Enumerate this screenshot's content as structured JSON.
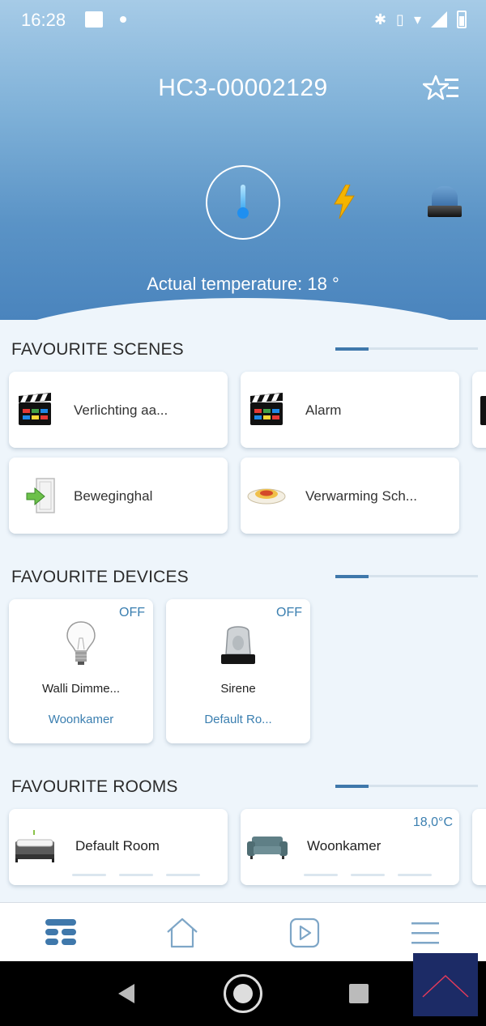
{
  "status_bar": {
    "time": "16:28",
    "icons": [
      "image-icon",
      "dot-icon",
      "bluetooth-icon",
      "vibrate-icon",
      "wifi-icon",
      "signal-icon",
      "battery-icon"
    ]
  },
  "header": {
    "title": "HC3-00002129",
    "actual_temperature_label": "Actual temperature:",
    "actual_temperature_value": "18 °"
  },
  "sections": {
    "scenes": {
      "title": "FAVOURITE SCENES",
      "items": [
        {
          "label": "Verlichting aa...",
          "icon": "clapperboard-icon"
        },
        {
          "label": "Alarm",
          "icon": "clapperboard-icon"
        },
        {
          "label": "Beweginghal",
          "icon": "door-arrow-icon"
        },
        {
          "label": "Verwarming Sch...",
          "icon": "pasta-plate-icon"
        }
      ]
    },
    "devices": {
      "title": "FAVOURITE DEVICES",
      "items": [
        {
          "name": "Walli Dimme...",
          "state": "OFF",
          "room": "Woonkamer",
          "icon": "light-bulb-icon"
        },
        {
          "name": "Sirene",
          "state": "OFF",
          "room": "Default Ro...",
          "icon": "siren-icon"
        }
      ]
    },
    "rooms": {
      "title": "FAVOURITE ROOMS",
      "items": [
        {
          "name": "Default Room",
          "temperature": "",
          "icon": "bed-icon"
        },
        {
          "name": "Woonkamer",
          "temperature": "18,0°C",
          "icon": "sofa-icon"
        }
      ]
    }
  },
  "colors": {
    "accent": "#3b7fb0",
    "header_top": "#a6cbe7",
    "header_bottom": "#4a84bd"
  }
}
